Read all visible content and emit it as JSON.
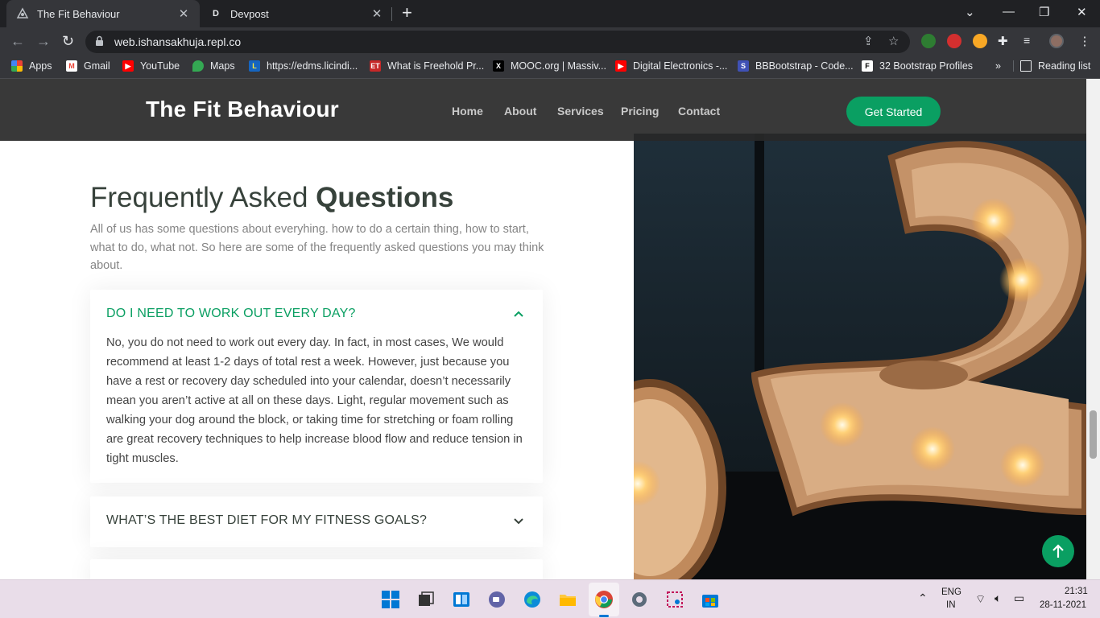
{
  "browser": {
    "tabs": [
      {
        "title": "The Fit Behaviour",
        "active": true
      },
      {
        "title": "Devpost",
        "active": false
      }
    ],
    "url": "web.ishansakhuja.repl.co",
    "bookmarks": [
      {
        "label": "Apps",
        "icon": "apps-grid-icon"
      },
      {
        "label": "Gmail",
        "icon": "gmail-icon"
      },
      {
        "label": "YouTube",
        "icon": "youtube-icon"
      },
      {
        "label": "Maps",
        "icon": "maps-icon"
      },
      {
        "label": "https://edms.licindi...",
        "icon": "lic-icon"
      },
      {
        "label": "What is Freehold Pr...",
        "icon": "et-icon"
      },
      {
        "label": "MOOC.org | Massiv...",
        "icon": "mooc-icon"
      },
      {
        "label": "Digital Electronics -...",
        "icon": "youtube-icon"
      },
      {
        "label": "BBBootstrap - Code...",
        "icon": "bbbootstrap-icon"
      },
      {
        "label": "32 Bootstrap Profiles",
        "icon": "f-icon"
      }
    ],
    "bookmarks_overflow": "»",
    "reading_list": "Reading list"
  },
  "site": {
    "brand": "The Fit Behaviour",
    "nav": [
      "Home",
      "About",
      "Services",
      "Pricing",
      "Contact"
    ],
    "cta": "Get Started",
    "accent": "#0a9f62"
  },
  "faq": {
    "title_light": "Frequently Asked ",
    "title_bold": "Questions",
    "description": "All of us has some questions about everyhing. how to do a certain thing, how to start, what to do, what not. So here are some of the frequently asked questions you may think about.",
    "items": [
      {
        "question": "DO I NEED TO WORK OUT EVERY DAY?",
        "expanded": true,
        "answer": "No, you do not need to work out every day. In fact, in most cases, We would recommend at least 1-2 days of total rest a week. However, just because you have a rest or recovery day scheduled into your calendar, doesn’t necessarily mean you aren’t active at all on these days. Light, regular movement such as walking your dog around the block, or taking time for stretching or foam rolling are great recovery techniques to help increase blood flow and reduce tension in tight muscles."
      },
      {
        "question": "WHAT’S THE BEST DIET FOR MY FITNESS GOALS?",
        "expanded": false
      }
    ]
  },
  "taskbar": {
    "lang_top": "ENG",
    "lang_bottom": "IN",
    "time": "21:31",
    "date": "28-11-2021"
  }
}
